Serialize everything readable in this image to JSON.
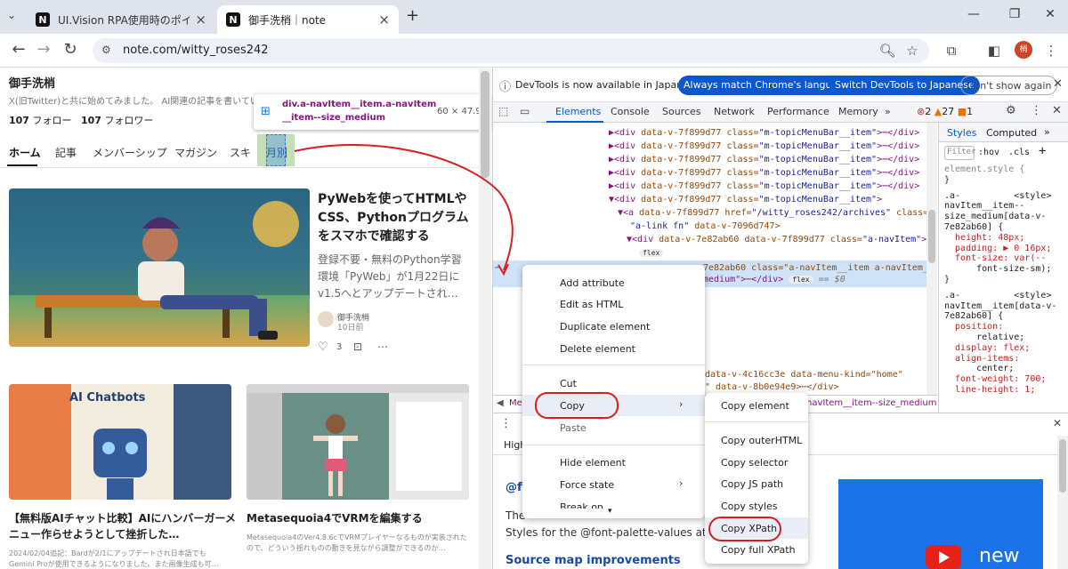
{
  "browser": {
    "tabs": [
      {
        "title": "UI.Vision RPA使用時のポイント | ",
        "icon": "N"
      },
      {
        "title": "御手洗梢｜note",
        "icon": "N"
      }
    ],
    "new_tab": "+",
    "url": "note.com/witty_roses242",
    "avatar_text": "梢"
  },
  "profile": {
    "name": "御手洗梢",
    "bio": "X(旧Twitter)と共に始めてみました。 AI関連の記事を書いていき",
    "following_count": "107",
    "following_label": "フォロー",
    "followers_count": "107",
    "followers_label": "フォロワー"
  },
  "tooltip": {
    "selector_line1": "div.a-navItem__item.a-navItem",
    "selector_line2": "__item--size_medium",
    "size": "60 × 47.99"
  },
  "page_tabs": [
    "ホーム",
    "記事",
    "メンバーシップ",
    "マガジン",
    "スキ",
    "月別"
  ],
  "articles": {
    "featured": {
      "title": "PyWebを使ってHTMLやCSS、Pythonプログラムをスマホで確認する",
      "excerpt": "登録不要・無料のPython学習環境「PyWeb」が1月22日にv1.5へとアップデートされ…",
      "author": "御手洗梢",
      "date": "10日前",
      "likes": "3"
    },
    "card1": {
      "image_text": "AI Chatbots",
      "title": "【無料版AIチャット比較】AIにハンバーガーメニュー作らせようとして挫折した…",
      "excerpt_line1": "2024/02/04追記：Bardが2/1にアップデートされ日本語でも",
      "excerpt_line2": "Gemini Proが使用できるようになりました。また画像生成も可…"
    },
    "card2": {
      "title": "Metasequoia4でVRMを編集する",
      "excerpt_line1": "Metasequoia4のVer4.8.6cでVRMプレイヤーなるものが実装された",
      "excerpt_line2": "ので、どういう揺れものの動きを見ながら調整ができるのか…"
    }
  },
  "devtools": {
    "info_text": "DevTools is now available in Japanese!",
    "btn_match": "Always match Chrome's language",
    "btn_switch": "Switch DevTools to Japanese",
    "btn_dont_show": "Don't show again",
    "tabs": [
      "Elements",
      "Console",
      "Sources",
      "Network",
      "Performance",
      "Memory",
      "»"
    ],
    "errors": "2",
    "warnings": "27",
    "info": "1",
    "code_lines": [
      {
        "indent": 1,
        "open": "▶",
        "text_tag": "<div",
        "attr": " data-v-7f899d77 class=",
        "val": "\"m-topicMenuBar__item\"",
        "rest": ">⋯</div>"
      },
      {
        "indent": 1,
        "open": "▶",
        "text_tag": "<div",
        "attr": " data-v-7f899d77 class=",
        "val": "\"m-topicMenuBar__item\"",
        "rest": ">⋯</div>"
      },
      {
        "indent": 1,
        "open": "▶",
        "text_tag": "<div",
        "attr": " data-v-7f899d77 class=",
        "val": "\"m-topicMenuBar__item\"",
        "rest": ">⋯</div>"
      },
      {
        "indent": 1,
        "open": "▶",
        "text_tag": "<div",
        "attr": " data-v-7f899d77 class=",
        "val": "\"m-topicMenuBar__item\"",
        "rest": ">⋯</div>"
      },
      {
        "indent": 1,
        "open": "▶",
        "text_tag": "<div",
        "attr": " data-v-7f899d77 class=",
        "val": "\"m-topicMenuBar__item\"",
        "rest": ">⋯</div>"
      },
      {
        "indent": 1,
        "open": "▼",
        "text_tag": "<div",
        "attr": " data-v-7f899d77 class=",
        "val": "\"m-topicMenuBar__item\"",
        "rest": ">"
      },
      {
        "indent": 2,
        "open": "▼",
        "text_tag": "<a",
        "attr": " data-v-7f899d77 href=",
        "val": "\"/witty_roses242/archives\"",
        "rest": " class="
      },
      {
        "indent": 3,
        "open": "",
        "text_tag": "",
        "attr": "",
        "val": "\"a-link fn\"",
        "rest": " data-v-7096d747>"
      },
      {
        "indent": 3,
        "open": "▼",
        "text_tag": "<div",
        "attr": " data-v-7e82ab60 data-v-7f899d77 class=",
        "val": "\"a-navItem\"",
        "rest": ">"
      }
    ],
    "flex_badge": "flex",
    "selected_line1": "7e82ab60 class=\"a-navItem__item a-navItem_",
    "selected_line2": "medium\">⋯</div>",
    "selected_suffix": "== $0",
    "lower_line1": "data-v-4c16cc3e data-menu-kind=\"home\"",
    "lower_line2": "\" data-v-8b0e94e9>⋯</div>",
    "crumb_left": "Me",
    "crumb_right": "navItem__item--size_medium",
    "styles_tabs": [
      "Styles",
      "Computed",
      "»"
    ],
    "filter_placeholder": "Filter",
    "hov": ":hov",
    "cls": ".cls",
    "style_lines": [
      "element.style {",
      "}",
      ".a-          <style>",
      "navItem__item--",
      "size_medium[data-v-",
      "7e82ab60] {",
      "  height: 48px;",
      "  padding: ▶ 0 16px;",
      "  font-size: var(--",
      "      font-size-sm);",
      "}",
      ".a-          <style>",
      "navItem__item[data-v-",
      "7e82ab60] {",
      "  position:",
      "      relative;",
      "  display: flex;",
      "  align-items:",
      "      center;",
      "  font-weight: 700;",
      "  line-height: 1;"
    ],
    "drawer_text": {
      "highlights": "High",
      "heading1": "@f",
      "body1": "The",
      "body2": "Styles for the @font-palette-values at-rul",
      "heading2": "Source map improvements",
      "new_text": "new"
    }
  },
  "context_menu": {
    "items": [
      "Add attribute",
      "Edit as HTML",
      "Duplicate element",
      "Delete element",
      "Cut",
      "Copy",
      "Paste",
      "Hide element",
      "Force state",
      "Break on"
    ]
  },
  "copy_submenu": {
    "items": [
      "Copy element",
      "Copy outerHTML",
      "Copy selector",
      "Copy JS path",
      "Copy styles",
      "Copy XPath",
      "Copy full XPath"
    ]
  },
  "colors": {
    "accent": "#1a73e8",
    "highlight": "#d81e1e"
  }
}
